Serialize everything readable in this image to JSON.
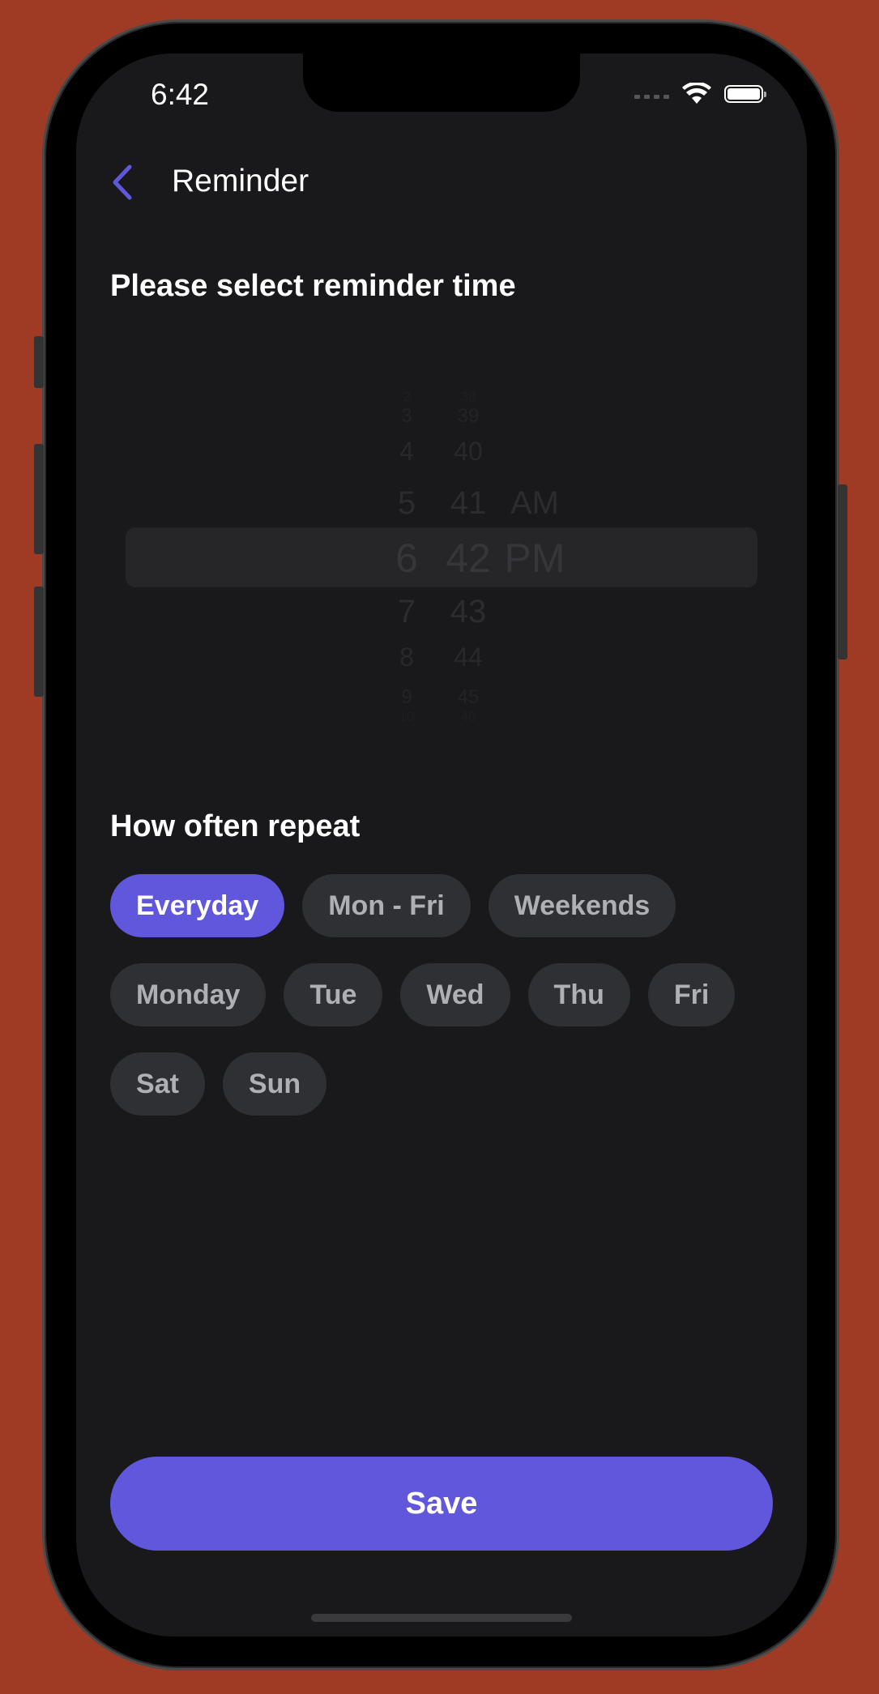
{
  "status_bar": {
    "time": "6:42"
  },
  "header": {
    "title": "Reminder"
  },
  "picker": {
    "label": "Please select reminder time",
    "hours": [
      "2",
      "3",
      "4",
      "5",
      "6",
      "7",
      "8",
      "9",
      "10"
    ],
    "minutes": [
      "38",
      "39",
      "40",
      "41",
      "42",
      "43",
      "44",
      "45",
      "46"
    ],
    "periods": [
      "AM",
      "PM"
    ],
    "selected": {
      "hour": "6",
      "minute": "42",
      "period": "PM"
    }
  },
  "repeat": {
    "label": "How often repeat",
    "options": [
      {
        "label": "Everyday",
        "selected": true
      },
      {
        "label": "Mon - Fri",
        "selected": false
      },
      {
        "label": "Weekends",
        "selected": false
      },
      {
        "label": "Monday",
        "selected": false
      },
      {
        "label": "Tue",
        "selected": false
      },
      {
        "label": "Wed",
        "selected": false
      },
      {
        "label": "Thu",
        "selected": false
      },
      {
        "label": "Fri",
        "selected": false
      },
      {
        "label": "Sat",
        "selected": false
      },
      {
        "label": "Sun",
        "selected": false
      }
    ]
  },
  "save_label": "Save",
  "colors": {
    "background": "#9f3b25",
    "screen": "#19191b",
    "accent": "#6157dc",
    "chip": "#2f3033",
    "chip_text": "#aeb0b6"
  }
}
